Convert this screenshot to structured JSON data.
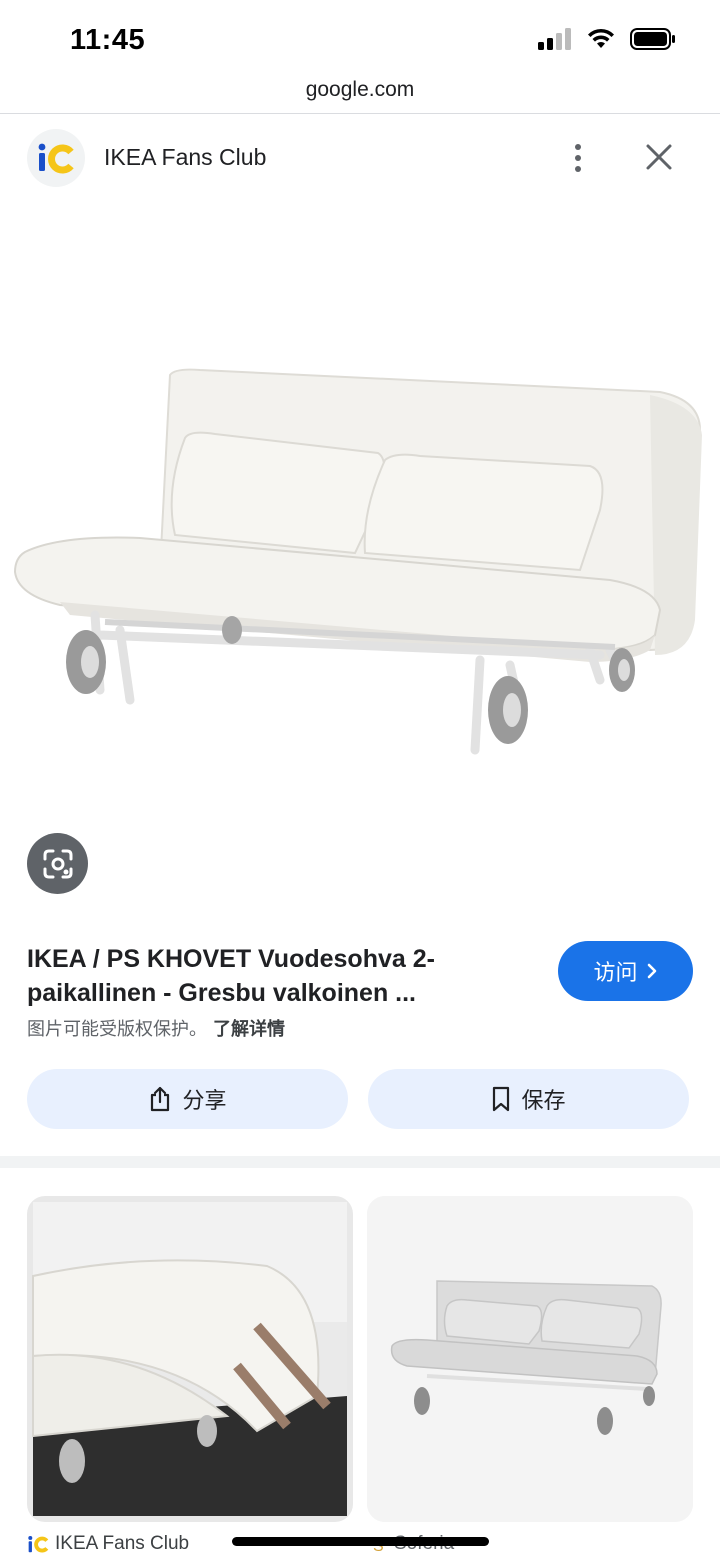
{
  "status_bar": {
    "time": "11:45",
    "icons": [
      "signal-icon",
      "wifi-icon",
      "battery-icon"
    ]
  },
  "browser": {
    "url": "google.com"
  },
  "source": {
    "logo_text": "iC",
    "name": "IKEA Fans Club",
    "logo_colors": {
      "i": "#1a4fc9",
      "c": "#f5c518"
    }
  },
  "main_image": {
    "alt": "IKEA PS KHOVET sofa bed in white"
  },
  "result": {
    "title": "IKEA / PS KHOVET Vuodesohva 2-paikallinen - Gresbu valkoinen ...",
    "copyright_notice": "图片可能受版权保护。",
    "learn_more": "了解详情",
    "visit_label": "访问"
  },
  "actions": {
    "share_label": "分享",
    "save_label": "保存"
  },
  "related": [
    {
      "source": "IKEA Fans Club"
    },
    {
      "source": "Soferia"
    }
  ],
  "colors": {
    "accent": "#1a73e8",
    "action_bg": "#e8f0fe",
    "lens_bg": "#5f6368"
  }
}
